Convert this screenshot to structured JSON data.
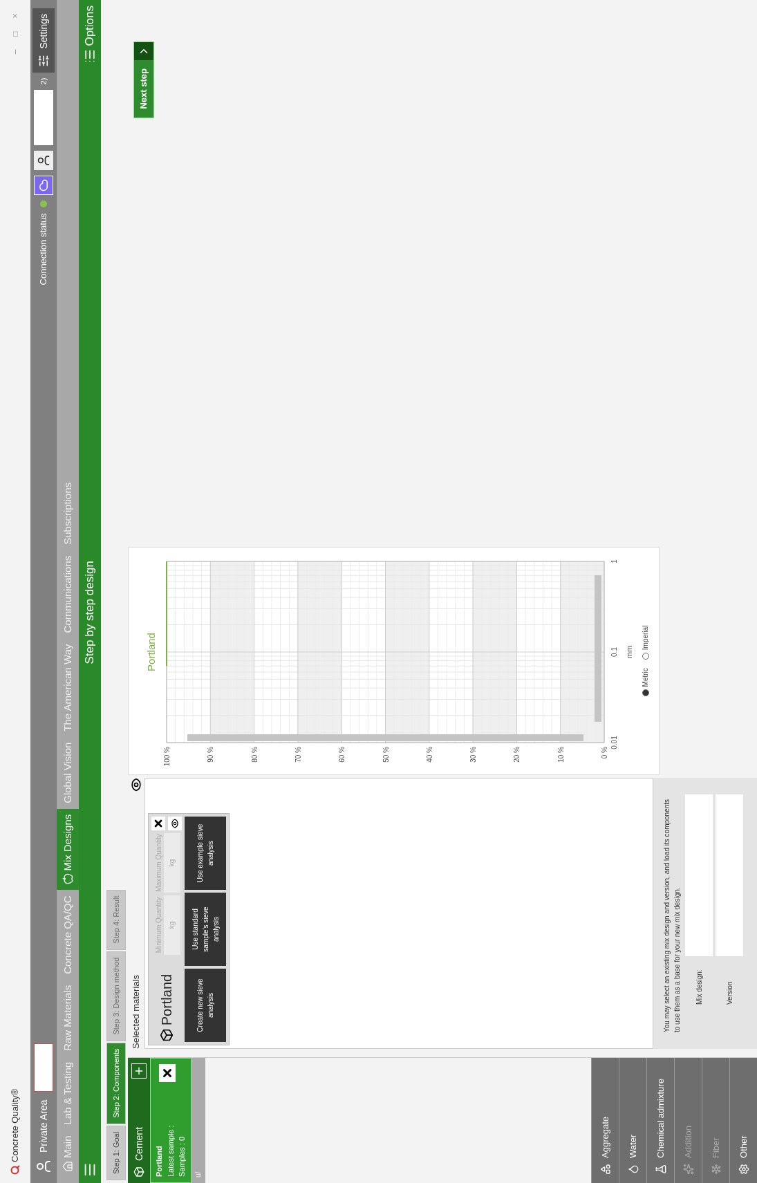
{
  "window": {
    "title": "Concrete Quality®",
    "controls": [
      "–",
      "□",
      "×"
    ]
  },
  "top_bar": {
    "private_area_label": "Private Area",
    "connection_label": "Connection status",
    "help_text": "2)",
    "settings_label": "Settings"
  },
  "nav": [
    {
      "label": "Main",
      "kind": "home",
      "selected": false
    },
    {
      "label": "Lab & Testing",
      "kind": "plain",
      "selected": false
    },
    {
      "label": "Raw Materials",
      "kind": "plain",
      "selected": false
    },
    {
      "label": "Concrete QA/QC",
      "kind": "plain",
      "selected": false
    },
    {
      "label": "Mix Designs",
      "kind": "apple",
      "selected": true
    },
    {
      "label": "Global Vision",
      "kind": "plain",
      "selected": false
    },
    {
      "label": "The American Way",
      "kind": "plain",
      "selected": false
    },
    {
      "label": "Communications",
      "kind": "plain",
      "selected": false
    },
    {
      "label": "Subscriptions",
      "kind": "plain",
      "selected": false
    }
  ],
  "header": {
    "title": "Step by step design",
    "options_label": "Options"
  },
  "steps": [
    {
      "label": "Step 1: Goal",
      "selected": false,
      "disabled": false
    },
    {
      "label": "Step 2: Components",
      "selected": true,
      "disabled": false
    },
    {
      "label": "Step 3: Design method",
      "selected": false,
      "disabled": true
    },
    {
      "label": "Step 4: Result",
      "selected": false,
      "disabled": true
    }
  ],
  "components": {
    "category": "Cement",
    "items": [
      {
        "name": "Portland",
        "lines": [
          "Latest sample :",
          "Samples : 0"
        ]
      }
    ],
    "row_label": "u/"
  },
  "categories": [
    {
      "label": "Aggregate",
      "disabled": false
    },
    {
      "label": "Water",
      "disabled": false
    },
    {
      "label": "Chemical admixture",
      "disabled": false
    },
    {
      "label": "Addition",
      "disabled": true
    },
    {
      "label": "Fiber",
      "disabled": true
    },
    {
      "label": "Other",
      "disabled": false
    }
  ],
  "selected_materials": {
    "title": "Selected materials",
    "materials": [
      {
        "name": "Portland",
        "min_label": "Minimum Quantity",
        "max_label": "Maximum Quantity",
        "min_unit": "kg",
        "max_unit": "kg",
        "buttons": [
          "Create new sieve analysis",
          "Use standard sample's sieve analysis",
          "Use example sieve analysis"
        ]
      }
    ]
  },
  "mix_section": {
    "text": "You may select an existing mix design and version, and load its components to use them as a base for your new mix design.",
    "mix_design_label": "Mix design:",
    "version_label": "Version"
  },
  "chart": {
    "legend": "Portland",
    "axis_title": "mm",
    "size_labels": [
      "0.01",
      "0.1",
      "1"
    ],
    "percent_labels": [
      "100 %",
      "90 %",
      "80 %",
      "70 %",
      "60 %",
      "50 %",
      "40 %",
      "30 %",
      "20 %",
      "10 %",
      "0 %"
    ],
    "units": [
      {
        "label": "Metric",
        "selected": true
      },
      {
        "label": "Imperial",
        "selected": false
      }
    ]
  },
  "next_step": "Next step"
}
